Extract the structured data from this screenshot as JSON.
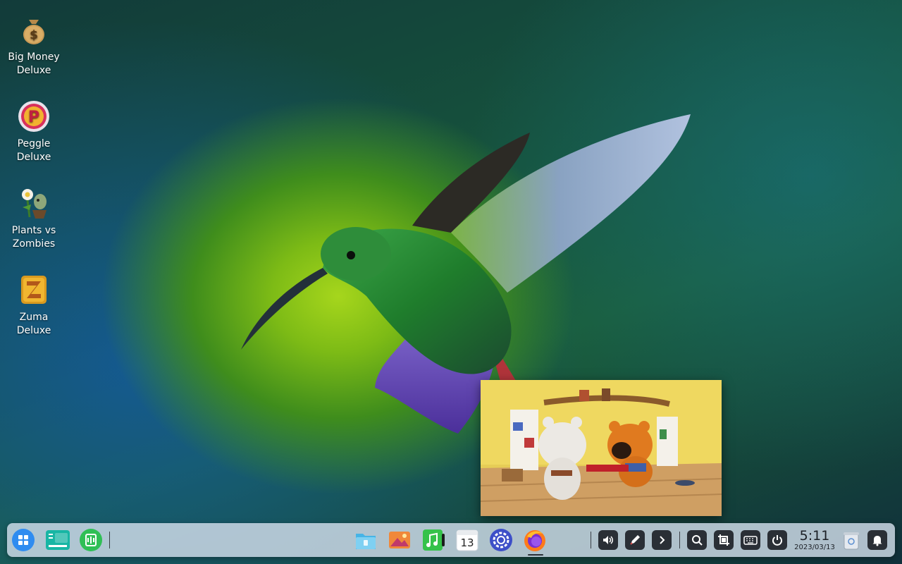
{
  "desktop": {
    "icons": [
      {
        "label": "Big Money Deluxe",
        "icon": "money-bag-icon"
      },
      {
        "label": "Peggle Deluxe",
        "icon": "peggle-icon"
      },
      {
        "label": "Plants vs Zombies",
        "icon": "plants-vs-zombies-icon"
      },
      {
        "label": "Zuma Deluxe",
        "icon": "zuma-icon"
      }
    ]
  },
  "pip_video": {
    "content": "cartoon-bears-video"
  },
  "taskbar": {
    "left": [
      {
        "name": "launcher",
        "icon": "launcher-grid-icon",
        "color": "#2f8cf0"
      },
      {
        "name": "multitask-view",
        "icon": "multitask-icon",
        "color": "#18b6a4"
      },
      {
        "name": "app-store",
        "icon": "store-icon",
        "color": "#2fbf55"
      }
    ],
    "center": [
      {
        "name": "file-manager",
        "icon": "folder-icon",
        "color": "#46b4e6"
      },
      {
        "name": "image-viewer",
        "icon": "image-viewer-icon",
        "color": "#f0883a"
      },
      {
        "name": "music",
        "icon": "music-icon",
        "color": "#35c24a"
      },
      {
        "name": "calendar",
        "icon": "calendar-icon",
        "calendar_day": "13"
      },
      {
        "name": "settings",
        "icon": "gear-icon",
        "color": "#3d4fc8"
      },
      {
        "name": "firefox",
        "icon": "firefox-icon",
        "active": true
      }
    ],
    "tray": [
      {
        "name": "volume",
        "icon": "volume-icon"
      },
      {
        "name": "pen",
        "icon": "pen-icon"
      },
      {
        "name": "expand",
        "icon": "chevron-right-icon"
      },
      {
        "name": "search",
        "icon": "search-icon"
      },
      {
        "name": "screenshot",
        "icon": "screenshot-icon"
      },
      {
        "name": "keyboard",
        "icon": "keyboard-icon"
      },
      {
        "name": "power",
        "icon": "power-icon"
      }
    ],
    "clock": {
      "time": "5:11",
      "date": "2023/03/13"
    },
    "trash": {
      "icon": "trash-icon"
    },
    "notifications": {
      "icon": "bell-icon"
    }
  }
}
